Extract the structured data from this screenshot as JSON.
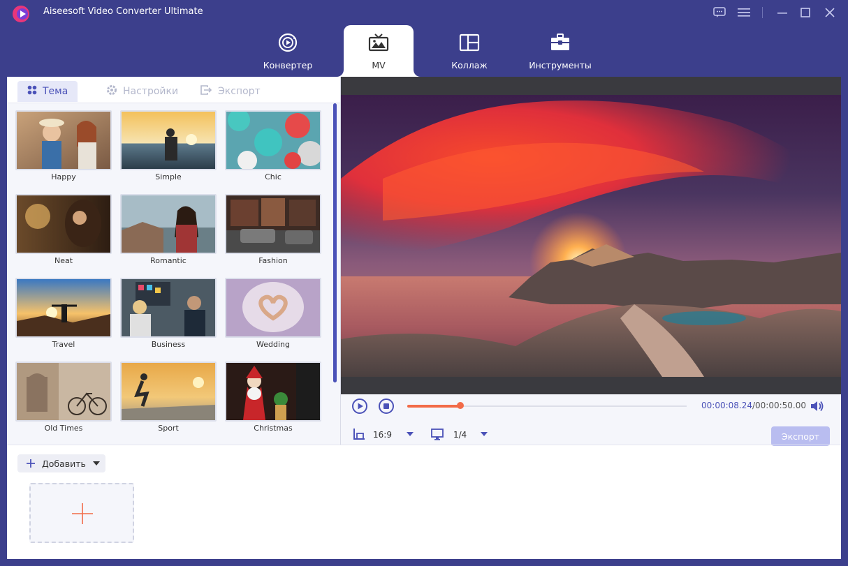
{
  "window": {
    "title": "Aiseesoft Video Converter Ultimate"
  },
  "nav": {
    "tabs": [
      {
        "label": "Конвертер",
        "icon": "convert-icon"
      },
      {
        "label": "MV",
        "icon": "tv-icon",
        "active": true
      },
      {
        "label": "Коллаж",
        "icon": "collage-icon"
      },
      {
        "label": "Инструменты",
        "icon": "toolbox-icon"
      }
    ]
  },
  "subtabs": [
    {
      "label": "Тема",
      "icon": "grid-icon",
      "active": true
    },
    {
      "label": "Настройки",
      "icon": "gear-icon"
    },
    {
      "label": "Экспорт",
      "icon": "export-icon"
    }
  ],
  "themes": [
    {
      "name": "Happy"
    },
    {
      "name": "Simple"
    },
    {
      "name": "Chic"
    },
    {
      "name": "Neat"
    },
    {
      "name": "Romantic"
    },
    {
      "name": "Fashion"
    },
    {
      "name": "Travel"
    },
    {
      "name": "Business"
    },
    {
      "name": "Wedding"
    },
    {
      "name": "Old Times"
    },
    {
      "name": "Sport"
    },
    {
      "name": "Christmas"
    }
  ],
  "player": {
    "current_time": "00:00:08.24",
    "total_time": "/00:00:50.00",
    "progress": 0.19,
    "aspect_ratio": "16:9",
    "page": "1/4",
    "export_label": "Экспорт"
  },
  "bottom": {
    "add_label": "Добавить"
  },
  "colors": {
    "chrome": "#3c3f8c",
    "accent": "#4b52b8",
    "progress": "#f26b48"
  }
}
